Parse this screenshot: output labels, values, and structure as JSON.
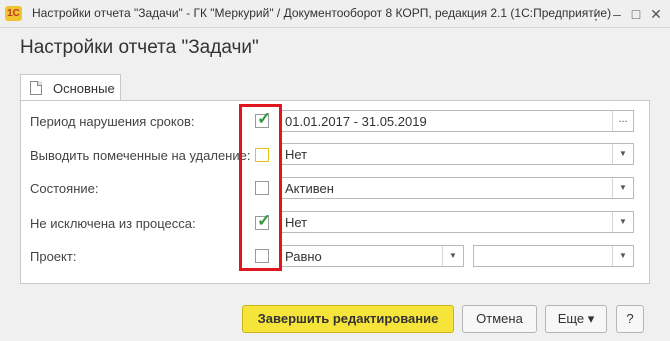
{
  "window": {
    "logo_text": "1С",
    "title": "Настройки отчета \"Задачи\" - ГК \"Меркурий\" / Документооборот 8 КОРП, редакция 2.1  (1С:Предприятие)",
    "controls": {
      "more": "⋮",
      "minimize": "–",
      "maximize": "□",
      "close": "✕"
    }
  },
  "form": {
    "title": "Настройки отчета \"Задачи\""
  },
  "tabs": [
    {
      "label": "Основные",
      "icon": "document-icon"
    }
  ],
  "rows": [
    {
      "label": "Период нарушения сроков:",
      "checked": true,
      "value": "01.01.2017 - 31.05.2019",
      "control": "choice"
    },
    {
      "label": "Выводить помеченные на удаление:",
      "checked": false,
      "value": "Нет",
      "control": "dropdown"
    },
    {
      "label": "Состояние:",
      "checked": false,
      "value": "Активен",
      "control": "dropdown"
    },
    {
      "label": "Не исключена из процесса:",
      "checked": true,
      "value": "Нет",
      "control": "dropdown"
    },
    {
      "label": "Проект:",
      "checked": false,
      "value": "Равно",
      "value2": "",
      "control": "dropdown"
    }
  ],
  "glyphs": {
    "check": "✓",
    "dropdown": "▼",
    "choice": "..."
  },
  "buttons": {
    "finish": "Завершить редактирование",
    "cancel": "Отмена",
    "more": "Еще",
    "more_arrow": "▾",
    "help": "?"
  },
  "colors": {
    "highlight": "#e0161f",
    "primary_button": "#f6e43b",
    "check": "#2f9a3f"
  }
}
